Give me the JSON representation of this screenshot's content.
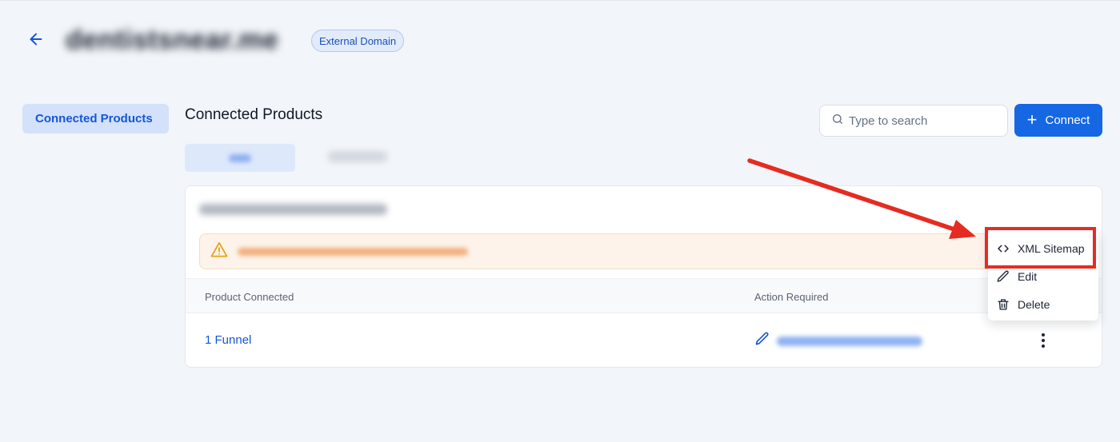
{
  "header": {
    "domain_title": "dentistsnear.me",
    "badge": "External Domain"
  },
  "sidebar": {
    "items": [
      {
        "label": "Connected Products",
        "active": true
      }
    ]
  },
  "main": {
    "title": "Connected Products",
    "search": {
      "placeholder": "Type to search",
      "value": ""
    },
    "connect_button": "Connect",
    "table": {
      "headers": [
        "Product Connected",
        "Action Required"
      ],
      "rows": [
        {
          "product": "1 Funnel"
        }
      ]
    }
  },
  "menu": {
    "items": [
      {
        "label": "XML Sitemap",
        "icon": "code-icon"
      },
      {
        "label": "Edit",
        "icon": "pencil-icon"
      },
      {
        "label": "Delete",
        "icon": "trash-icon"
      }
    ]
  },
  "annotation": {
    "color": "#e52c22"
  },
  "colors": {
    "accent": "#1667e4",
    "link": "#1656d8",
    "warning": "#f0a36b"
  }
}
